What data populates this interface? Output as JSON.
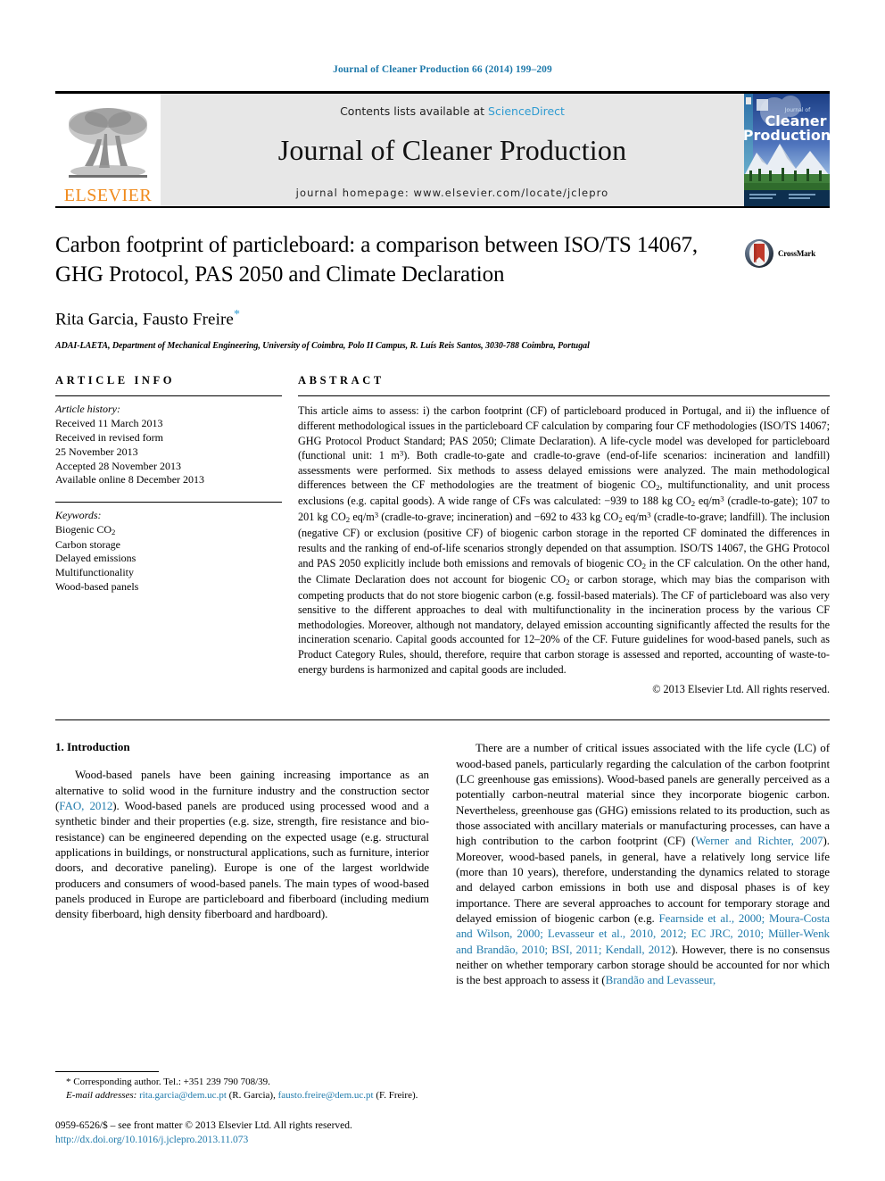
{
  "running_head": "Journal of Cleaner Production 66 (2014) 199–209",
  "masthead": {
    "contents_prefix": "Contents lists available at ",
    "sciencedirect": "ScienceDirect",
    "journal_title": "Journal of Cleaner Production",
    "homepage": "journal homepage: www.elsevier.com/locate/jclepro",
    "elsevier_wordmark": "ELSEVIER",
    "cover_line1": "Journal of",
    "cover_line2": "Cleaner",
    "cover_line3": "Production"
  },
  "article": {
    "title": "Carbon footprint of particleboard: a comparison between ISO/TS 14067, GHG Protocol, PAS 2050 and Climate Declaration",
    "authors": "Rita Garcia, Fausto Freire",
    "corresponding_marker": "*",
    "affiliation": "ADAI-LAETA, Department of Mechanical Engineering, University of Coimbra, Polo II Campus, R. Luís Reis Santos, 3030-788 Coimbra, Portugal",
    "crossmark_label": "CrossMark"
  },
  "article_info": {
    "heading": "ARTICLE INFO",
    "history_label": "Article history:",
    "history": [
      "Received 11 March 2013",
      "Received in revised form",
      "25 November 2013",
      "Accepted 28 November 2013",
      "Available online 8 December 2013"
    ],
    "keywords_label": "Keywords:",
    "keywords": [
      "Biogenic CO2",
      "Carbon storage",
      "Delayed emissions",
      "Multifunctionality",
      "Wood-based panels"
    ]
  },
  "abstract": {
    "heading": "ABSTRACT",
    "text_parts": [
      "This article aims to assess: i) the carbon footprint (CF) of particleboard produced in Portugal, and ii) the influence of different methodological issues in the particleboard CF calculation by comparing four CF methodologies (ISO/TS 14067; GHG Protocol Product Standard; PAS 2050; Climate Declaration). A life-cycle model was developed for particleboard (functional unit: 1 m",
      "). Both cradle-to-gate and cradle-to-grave (end-of-life scenarios: incineration and landfill) assessments were performed. Six methods to assess delayed emissions were analyzed. The main methodological differences between the CF methodologies are the treatment of biogenic CO",
      ", multifunctionality, and unit process exclusions (e.g. capital goods). A wide range of CFs was calculated: −939 to 188 kg CO",
      " eq/m",
      " (cradle-to-gate); 107 to 201 kg CO",
      " eq/m",
      " (cradle-to-grave; incineration) and −692 to 433 kg CO",
      " eq/m",
      " (cradle-to-grave; landfill). The inclusion (negative CF) or exclusion (positive CF) of biogenic carbon storage in the reported CF dominated the differences in results and the ranking of end-of-life scenarios strongly depended on that assumption. ISO/TS 14067, the GHG Protocol and PAS 2050 explicitly include both emissions and removals of biogenic CO",
      " in the CF calculation. On the other hand, the Climate Declaration does not account for biogenic CO",
      " or carbon storage, which may bias the comparison with competing products that do not store biogenic carbon (e.g. fossil-based materials). The CF of particleboard was also very sensitive to the different approaches to deal with multifunctionality in the incineration process by the various CF methodologies. Moreover, although not mandatory, delayed emission accounting significantly affected the results for the incineration scenario. Capital goods accounted for 12–20% of the CF. Future guidelines for wood-based panels, such as Product Category Rules, should, therefore, require that carbon storage is assessed and reported, accounting of waste-to-energy burdens is harmonized and capital goods are included."
    ],
    "copyright": "© 2013 Elsevier Ltd. All rights reserved."
  },
  "introduction": {
    "title": "1. Introduction",
    "left_p1_a": "Wood-based panels have been gaining increasing importance as an alternative to solid wood in the furniture industry and the construction sector (",
    "left_p1_ref1": "FAO, 2012",
    "left_p1_b": "). Wood-based panels are produced using processed wood and a synthetic binder and their properties (e.g. size, strength, fire resistance and bio-resistance) can be engineered depending on the expected usage (e.g. structural applications in buildings, or nonstructural applications, such as furniture, interior doors, and decorative paneling). Europe is one of the largest worldwide producers and consumers of wood-based panels. The main types of wood-based panels produced in Europe are particleboard and fiberboard (including medium density fiberboard, high density fiberboard and hardboard).",
    "right_p1_a": "There are a number of critical issues associated with the life cycle (LC) of wood-based panels, particularly regarding the calculation of the carbon footprint (LC greenhouse gas emissions). Wood-based panels are generally perceived as a potentially carbon-neutral material since they incorporate biogenic carbon. Nevertheless, greenhouse gas (GHG) emissions related to its production, such as those associated with ancillary materials or manufacturing processes, can have a high contribution to the carbon footprint (CF) (",
    "right_p1_ref1": "Werner and Richter, 2007",
    "right_p1_b": "). Moreover, wood-based panels, in general, have a relatively long service life (more than 10 years), therefore, understanding the dynamics related to storage and delayed carbon emissions in both use and disposal phases is of key importance. There are several approaches to account for temporary storage and delayed emission of biogenic carbon (e.g. ",
    "right_p1_ref2": "Fearnside et al., 2000; Moura-Costa and Wilson, 2000; Levasseur et al., 2010, 2012; EC JRC, 2010; Müller-Wenk and Brandão, 2010; BSI, 2011; Kendall, 2012",
    "right_p1_c": "). However, there is no consensus neither on whether temporary carbon storage should be accounted for nor which is the best approach to assess it (",
    "right_p1_ref3": "Brandão and Levasseur,"
  },
  "footnotes": {
    "corresponding": "* Corresponding author. Tel.: +351 239 790 708/39.",
    "email_label": "E-mail addresses:",
    "email1": "rita.garcia@dem.uc.pt",
    "email1_owner": " (R. Garcia), ",
    "email2": "fausto.freire@dem.uc.pt",
    "email2_owner": "(F. Freire).",
    "issn": "0959-6526/$ – see front matter © 2013 Elsevier Ltd. All rights reserved.",
    "doi": "http://dx.doi.org/10.1016/j.jclepro.2013.11.073"
  },
  "colors": {
    "link": "#1f7aab",
    "sciencedirect": "#2f9bd1",
    "elsevier_orange": "#f08a1b",
    "masthead_bg": "#e7e7e7"
  }
}
